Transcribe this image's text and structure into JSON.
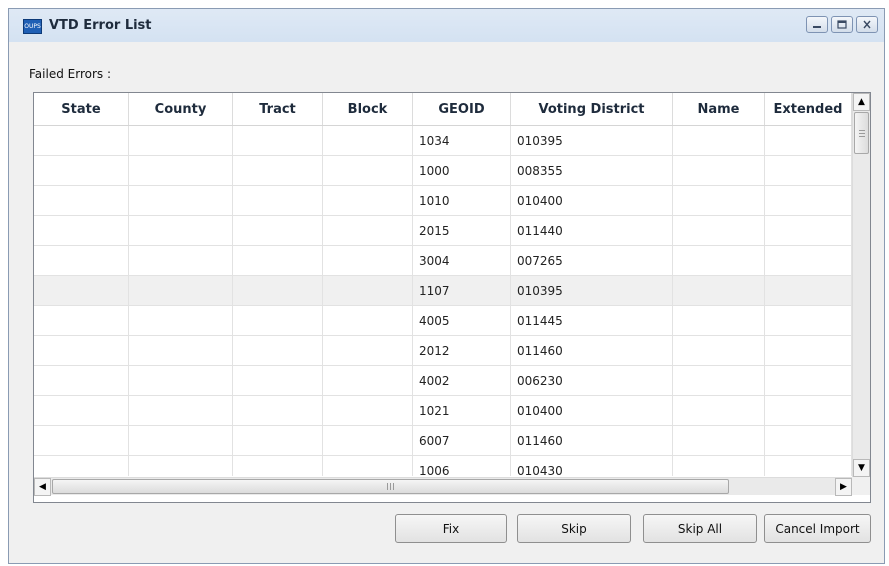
{
  "window": {
    "title": "VTD Error List",
    "app_icon_text": "OUPS",
    "controls": {
      "minimize_icon": "minimize-icon",
      "maximize_icon": "maximize-icon",
      "close_icon": "close-icon"
    }
  },
  "section": {
    "label": "Failed Errors :"
  },
  "table": {
    "columns": [
      "State",
      "County",
      "Tract",
      "Block",
      "GEOID",
      "Voting District",
      "Name",
      "Extended"
    ],
    "rows": [
      [
        "",
        "",
        "",
        "",
        "1034",
        "010395",
        "",
        ""
      ],
      [
        "",
        "",
        "",
        "",
        "1000",
        "008355",
        "",
        ""
      ],
      [
        "",
        "",
        "",
        "",
        "1010",
        "010400",
        "",
        ""
      ],
      [
        "",
        "",
        "",
        "",
        "2015",
        "011440",
        "",
        ""
      ],
      [
        "",
        "",
        "",
        "",
        "3004",
        "007265",
        "",
        ""
      ],
      [
        "",
        "",
        "",
        "",
        "1107",
        "010395",
        "",
        ""
      ],
      [
        "",
        "",
        "",
        "",
        "4005",
        "011445",
        "",
        ""
      ],
      [
        "",
        "",
        "",
        "",
        "2012",
        "011460",
        "",
        ""
      ],
      [
        "",
        "",
        "",
        "",
        "4002",
        "006230",
        "",
        ""
      ],
      [
        "",
        "",
        "",
        "",
        "1021",
        "010400",
        "",
        ""
      ],
      [
        "",
        "",
        "",
        "",
        "6007",
        "011460",
        "",
        ""
      ],
      [
        "",
        "",
        "",
        "",
        "1006",
        "010430",
        "",
        ""
      ]
    ],
    "highlighted_row": 5
  },
  "buttons": {
    "fix": "Fix",
    "skip": "Skip",
    "skip_all": "Skip All",
    "cancel_import": "Cancel Import"
  },
  "colors": {
    "title_bar": "#d9e4f2",
    "window_bg": "#f0f0f0",
    "grid_bg": "#ffffff",
    "alt_row": "#f0f0f0"
  }
}
